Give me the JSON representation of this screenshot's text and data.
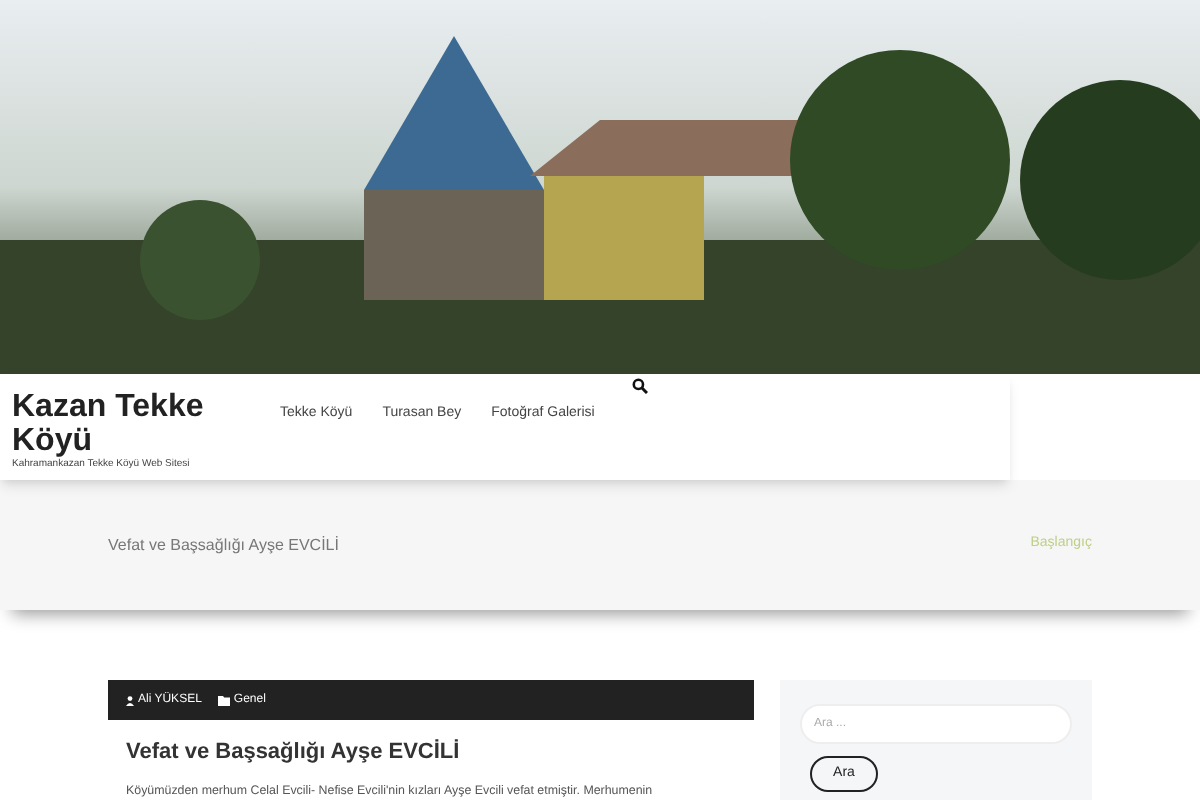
{
  "site": {
    "title": "Kazan Tekke Köyü",
    "tagline": "Kahramankazan Tekke Köyü Web Sitesi"
  },
  "nav": [
    {
      "label": "Tekke Köyü"
    },
    {
      "label": "Turasan Bey"
    },
    {
      "label": "Fotoğraf Galerisi"
    }
  ],
  "breadcrumb": {
    "page_title": "Vefat ve Başsağlığı Ayşe EVCİLİ",
    "home_link": "Başlangıç"
  },
  "post": {
    "author": "Ali YÜKSEL",
    "category": "Genel",
    "title": "Vefat ve Başsağlığı Ayşe EVCİLİ",
    "excerpt": "Köyümüzden merhum Celal Evcili- Nefise Evcili'nin kızları Ayşe Evcili vefat etmiştir. Merhumenin"
  },
  "sidebar": {
    "search": {
      "placeholder": "Ara ...",
      "button": "Ara"
    }
  }
}
